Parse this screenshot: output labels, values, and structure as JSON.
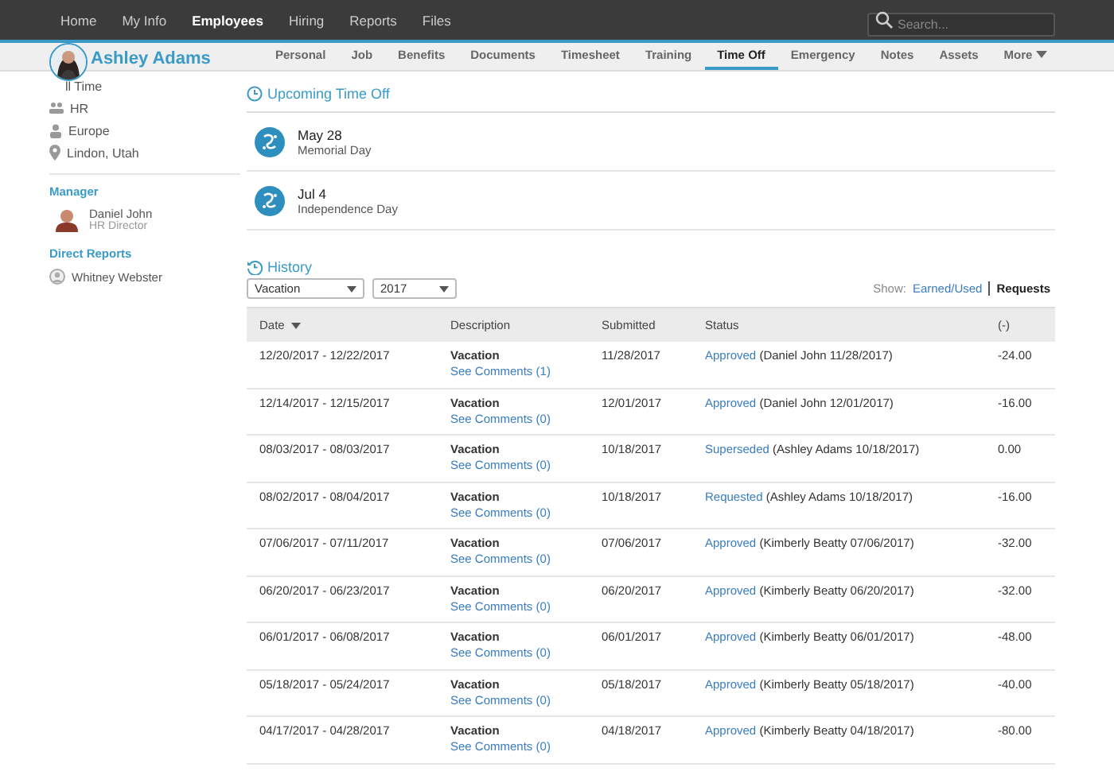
{
  "nav": {
    "items": [
      {
        "label": "Home",
        "selected": false
      },
      {
        "label": "My Info",
        "selected": false
      },
      {
        "label": "Employees",
        "selected": true
      },
      {
        "label": "Hiring",
        "selected": false
      },
      {
        "label": "Reports",
        "selected": false
      },
      {
        "label": "Files",
        "selected": false
      }
    ],
    "search": {
      "placeholder": "Search..."
    }
  },
  "profile": {
    "name": "Ashley Adams"
  },
  "tabs": [
    {
      "label": "Personal",
      "selected": false
    },
    {
      "label": "Job",
      "selected": false
    },
    {
      "label": "Benefits",
      "selected": false
    },
    {
      "label": "Documents",
      "selected": false
    },
    {
      "label": "Timesheet",
      "selected": false
    },
    {
      "label": "Training",
      "selected": false
    },
    {
      "label": "Time Off",
      "selected": true
    },
    {
      "label": "Emergency",
      "selected": false
    },
    {
      "label": "Notes",
      "selected": false
    },
    {
      "label": "Assets",
      "selected": false
    }
  ],
  "more_tab": {
    "label": "More"
  },
  "sidebar": {
    "info": [
      {
        "kind": "plain",
        "text": "ll Time"
      },
      {
        "kind": "department",
        "text": "HR"
      },
      {
        "kind": "division",
        "text": "Europe"
      },
      {
        "kind": "location",
        "text": "Lindon, Utah"
      }
    ],
    "manager_heading": "Manager",
    "manager": {
      "name": "Daniel John",
      "title": "HR Director"
    },
    "reports_heading": "Direct Reports",
    "reports": [
      {
        "name": "Whitney Webster"
      }
    ]
  },
  "upcoming": {
    "title": "Upcoming Time Off",
    "items": [
      {
        "date": "May 28",
        "name": "Memorial Day"
      },
      {
        "date": "Jul 4",
        "name": "Independence Day"
      }
    ]
  },
  "history": {
    "title": "History",
    "filters": [
      {
        "value": "Vacation"
      },
      {
        "value": "2017"
      }
    ],
    "show_label": "Show:",
    "show_options": [
      {
        "label": "Earned/Used",
        "selected": false
      },
      {
        "label": "Requests",
        "selected": true
      }
    ],
    "columns": [
      {
        "label": "Date",
        "sorted": true
      },
      {
        "label": "Description",
        "sorted": false
      },
      {
        "label": "Submitted",
        "sorted": false
      },
      {
        "label": "Status",
        "sorted": false
      },
      {
        "label": "(-)",
        "sorted": false
      }
    ],
    "rows": [
      {
        "date": "12/20/2017 - 12/22/2017",
        "type": "Vacation",
        "comments": "See Comments (1)",
        "submitted": "11/28/2017",
        "status": "Approved",
        "status_detail": "(Daniel John 11/28/2017)",
        "amount": "-24.00"
      },
      {
        "date": "12/14/2017 - 12/15/2017",
        "type": "Vacation",
        "comments": "See Comments (0)",
        "submitted": "12/01/2017",
        "status": "Approved",
        "status_detail": "(Daniel John 12/01/2017)",
        "amount": "-16.00"
      },
      {
        "date": "08/03/2017 - 08/03/2017",
        "type": "Vacation",
        "comments": "See Comments (0)",
        "submitted": "10/18/2017",
        "status": "Superseded",
        "status_detail": "(Ashley Adams 10/18/2017)",
        "amount": "0.00"
      },
      {
        "date": "08/02/2017 - 08/04/2017",
        "type": "Vacation",
        "comments": "See Comments (0)",
        "submitted": "10/18/2017",
        "status": "Requested",
        "status_detail": "(Ashley Adams 10/18/2017)",
        "amount": "-16.00"
      },
      {
        "date": "07/06/2017 - 07/11/2017",
        "type": "Vacation",
        "comments": "See Comments (0)",
        "submitted": "07/06/2017",
        "status": "Approved",
        "status_detail": "(Kimberly Beatty 07/06/2017)",
        "amount": "-32.00"
      },
      {
        "date": "06/20/2017 - 06/23/2017",
        "type": "Vacation",
        "comments": "See Comments (0)",
        "submitted": "06/20/2017",
        "status": "Approved",
        "status_detail": "(Kimberly Beatty 06/20/2017)",
        "amount": "-32.00"
      },
      {
        "date": "06/01/2017 - 06/08/2017",
        "type": "Vacation",
        "comments": "See Comments (0)",
        "submitted": "06/01/2017",
        "status": "Approved",
        "status_detail": "(Kimberly Beatty 06/01/2017)",
        "amount": "-48.00"
      },
      {
        "date": "05/18/2017 - 05/24/2017",
        "type": "Vacation",
        "comments": "See Comments (0)",
        "submitted": "05/18/2017",
        "status": "Approved",
        "status_detail": "(Kimberly Beatty 05/18/2017)",
        "amount": "-40.00"
      },
      {
        "date": "04/17/2017 - 04/28/2017",
        "type": "Vacation",
        "comments": "See Comments (0)",
        "submitted": "04/18/2017",
        "status": "Approved",
        "status_detail": "(Kimberly Beatty 04/18/2017)",
        "amount": "-80.00"
      }
    ]
  }
}
